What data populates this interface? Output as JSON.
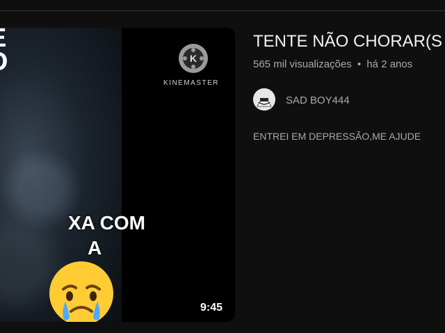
{
  "thumbnail": {
    "corner_text": "E\nD",
    "overlay_text": "XA COM\nA",
    "watermark_label": "KINEMASTER",
    "duration": "9:45",
    "emoji_icon": "sad-but-relieved-face-icon"
  },
  "video": {
    "title": "TENTE NÃO CHORAR(S",
    "views": "565 mil visualizações",
    "separator": "•",
    "age": "há 2 anos"
  },
  "channel": {
    "name": "SAD BOY444",
    "avatar_icon": "channel-avatar-icon"
  },
  "description": "ENTREI EM DEPRESSÃO,ME AJUDE"
}
